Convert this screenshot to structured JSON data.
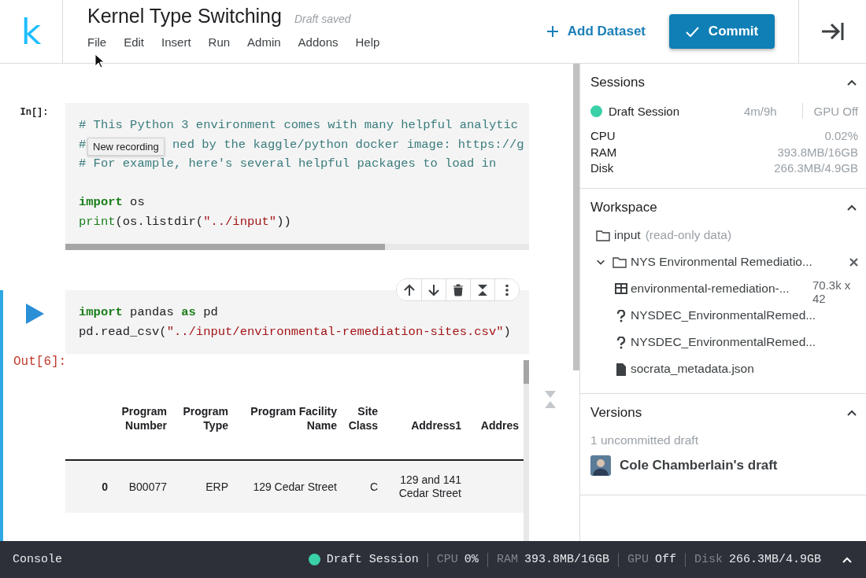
{
  "logo": "k",
  "notebook": {
    "title": "Kernel Type Switching",
    "save_status": "Draft saved"
  },
  "menu": [
    "File",
    "Edit",
    "Insert",
    "Run",
    "Admin",
    "Addons",
    "Help"
  ],
  "actions": {
    "add_dataset": "Add Dataset",
    "commit": "Commit"
  },
  "cells": [
    {
      "kind": "input",
      "prompt": "In[]:",
      "active": false,
      "tooltip": "New recording",
      "lines": [
        {
          "kind": "code",
          "tokens": [
            {
              "kind": "comment",
              "text": "# This Python 3 environment comes with many helpful analytic"
            }
          ]
        },
        {
          "kind": "code",
          "tokens": [
            {
              "kind": "comment",
              "text": "#"
            },
            {
              "kind": "comment",
              "text": "ned by the kaggle/python docker image: https://g",
              "after_tooltip": true
            }
          ]
        },
        {
          "kind": "code",
          "tokens": [
            {
              "kind": "comment",
              "text": "# For example, here's several helpful packages to load in"
            }
          ]
        },
        {
          "kind": "blank"
        },
        {
          "kind": "code",
          "tokens": [
            {
              "kind": "keyword",
              "text": "import"
            },
            {
              "kind": "plain",
              "text": " os"
            }
          ]
        },
        {
          "kind": "code",
          "tokens": [
            {
              "kind": "builtin",
              "text": "print"
            },
            {
              "kind": "plain",
              "text": "(os.listdir("
            },
            {
              "kind": "string",
              "text": "\"../input\""
            },
            {
              "kind": "plain",
              "text": "))"
            }
          ]
        }
      ]
    },
    {
      "kind": "run",
      "prompt": "Out[6]:",
      "active": true,
      "lines": [
        {
          "kind": "code",
          "tokens": [
            {
              "kind": "keyword",
              "text": "import"
            },
            {
              "kind": "plain",
              "text": " pandas "
            },
            {
              "kind": "keyword",
              "text": "as"
            },
            {
              "kind": "plain",
              "text": " pd"
            }
          ]
        },
        {
          "kind": "code",
          "tokens": [
            {
              "kind": "plain",
              "text": "pd.read_csv("
            },
            {
              "kind": "string",
              "text": "\"../input/environmental-remediation-sites.csv\""
            },
            {
              "kind": "plain",
              "text": ")"
            }
          ]
        }
      ],
      "table": {
        "columns": [
          "",
          "Program Number",
          "Program Type",
          "Program Facility Name",
          "Site Class",
          "Address1",
          "Addres"
        ],
        "rows": [
          [
            "0",
            "B00077",
            "ERP",
            "129 Cedar Street",
            "C",
            "129 and 141 Cedar Street",
            ""
          ]
        ]
      }
    }
  ],
  "sessions": {
    "title": "Sessions",
    "expanded": true,
    "name": "Draft Session",
    "running": true,
    "time": "4m/9h",
    "gpu": "GPU Off",
    "stats": [
      {
        "label": "CPU",
        "value": "0.02%"
      },
      {
        "label": "RAM",
        "value": "393.8MB/16GB"
      },
      {
        "label": "Disk",
        "value": "266.3MB/4.9GB"
      }
    ]
  },
  "workspace": {
    "title": "Workspace",
    "expanded": true,
    "tree": [
      {
        "kind": "folder",
        "name": "input",
        "note": "(read-only data)",
        "children": [
          {
            "kind": "folder",
            "name": "NYS Environmental Remediatio...",
            "expanded": true,
            "children": [
              {
                "kind": "table",
                "name": "environmental-remediation-...",
                "meta": "70.3k x 42"
              },
              {
                "kind": "unknown",
                "name": "NYSDEC_EnvironmentalRemed..."
              },
              {
                "kind": "unknown",
                "name": "NYSDEC_EnvironmentalRemed..."
              },
              {
                "kind": "file",
                "name": "socrata_metadata.json"
              }
            ]
          }
        ]
      }
    ]
  },
  "versions": {
    "title": "Versions",
    "expanded": true,
    "summary": "1 uncommitted draft",
    "draft": "Cole Chamberlain's draft"
  },
  "console": {
    "label": "Console",
    "session": "Draft Session",
    "running": true,
    "stats": [
      {
        "label": "CPU",
        "value": "0%"
      },
      {
        "label": "RAM",
        "value": "393.8MB/16GB"
      },
      {
        "label": "GPU",
        "value": "Off"
      },
      {
        "label": "Disk",
        "value": "266.3MB/4.9GB"
      }
    ]
  }
}
